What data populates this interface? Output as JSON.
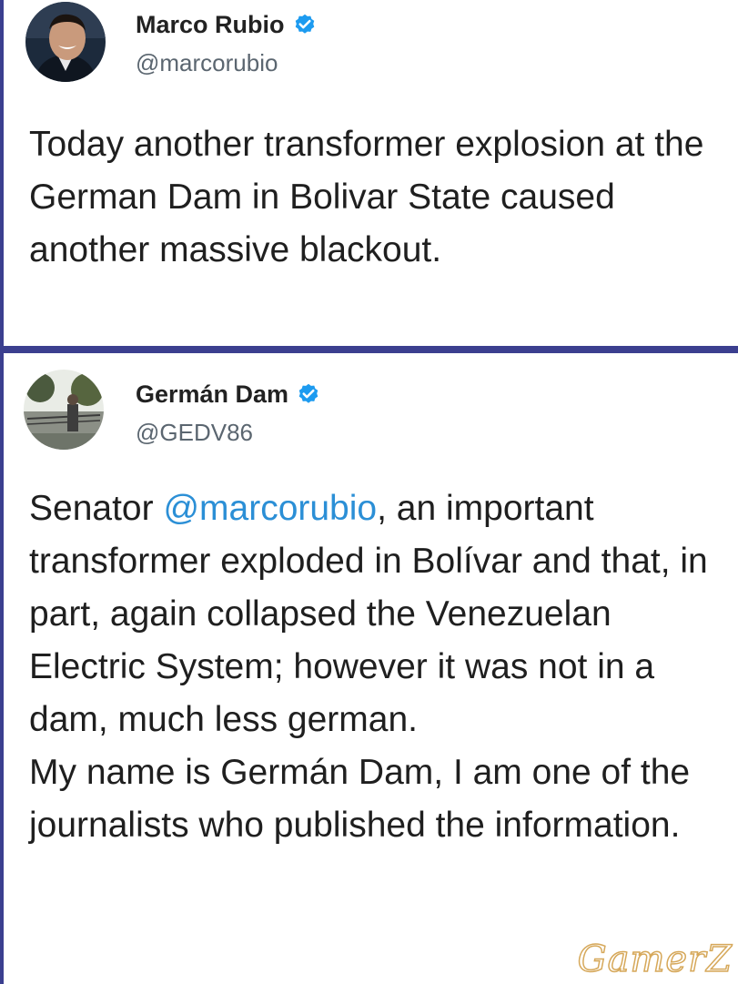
{
  "tweets": [
    {
      "author_name": "Marco Rubio",
      "handle": "@marcorubio",
      "verified_icon": "verified-badge-icon",
      "text": "Today another transformer explosion at the German Dam in Bolivar State caused another massive blackout."
    },
    {
      "author_name": "Germán Dam",
      "handle": "@GEDV86",
      "verified_icon": "verified-badge-icon",
      "text_before_mention": "Senator ",
      "mention": "@marcorubio",
      "text_after_mention": ", an important transformer exploded in Bolívar and that, in part, again collapsed the Venezuelan Electric System; however it was not in a dam, much less german.",
      "text_second_paragraph": "My name is Germán Dam, I am one of the journalists who published the information."
    }
  ],
  "watermark": "GamerZ",
  "colors": {
    "accent_border": "#3b3f8f",
    "mention": "#2b8fd6",
    "verified_badge": "#1d9bf0",
    "watermark_outline": "#d6a85a"
  }
}
